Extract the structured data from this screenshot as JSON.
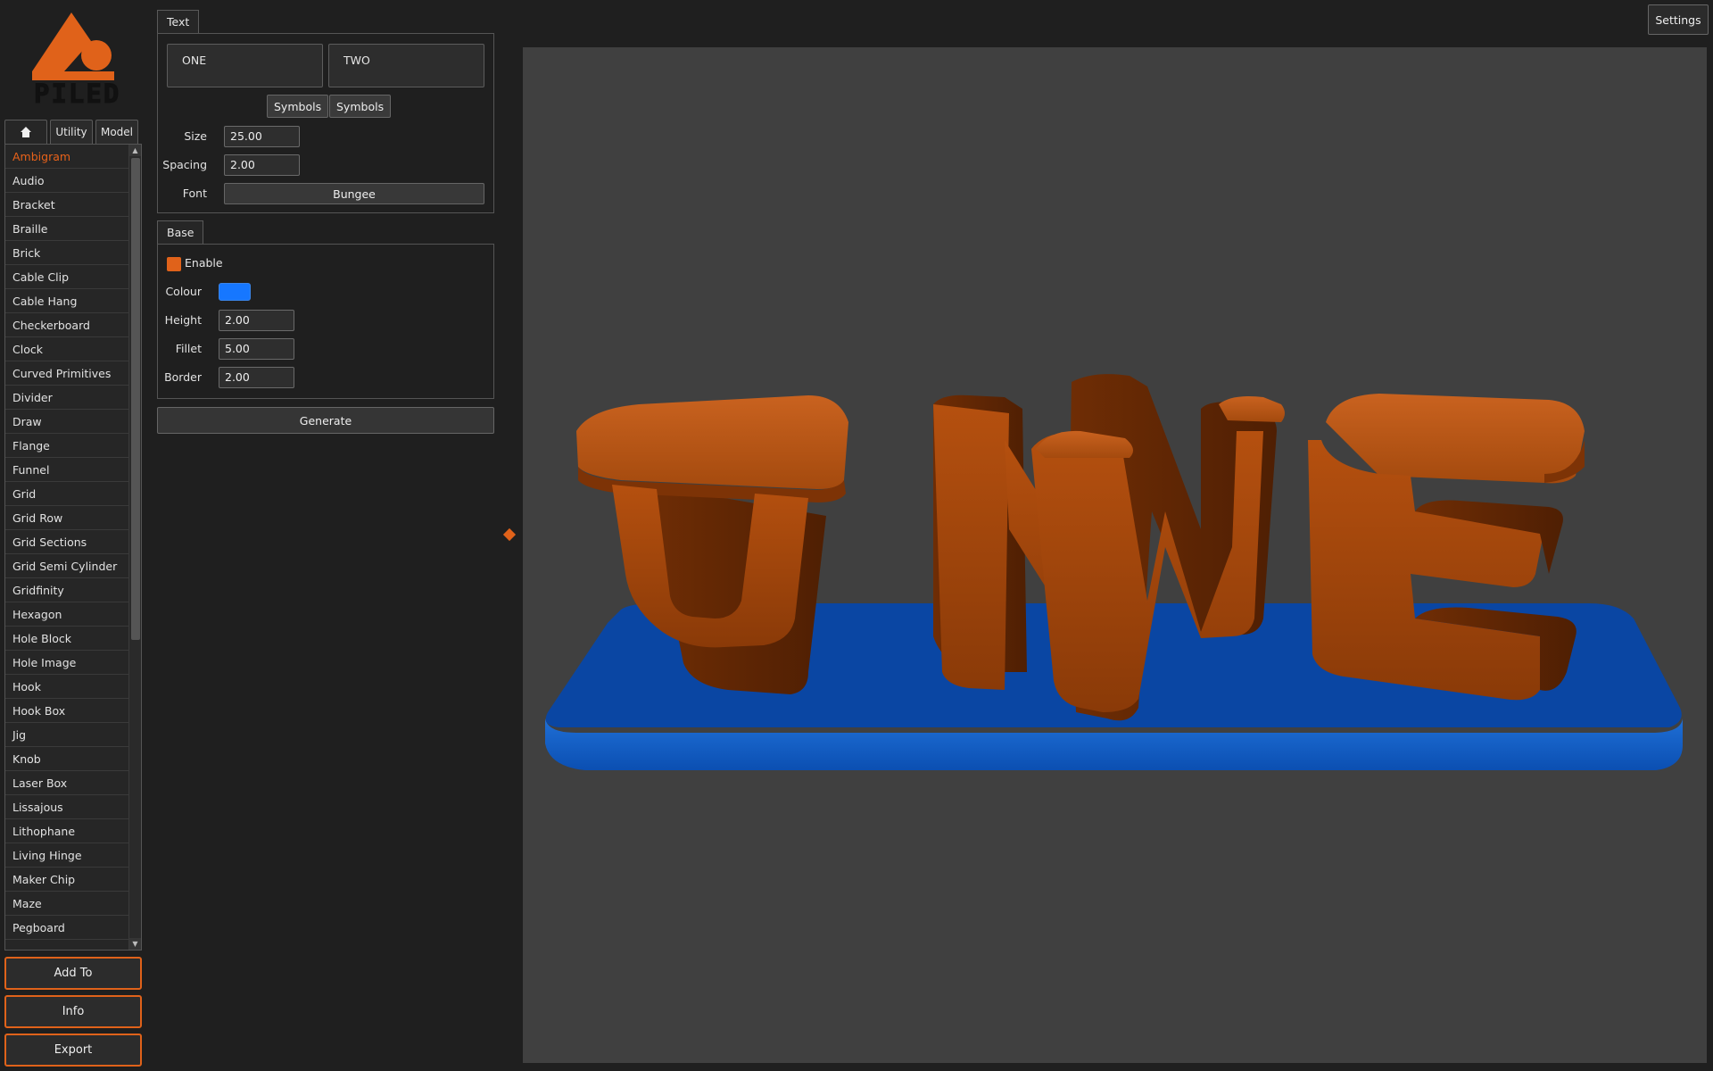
{
  "app": {
    "logo_text": "PILED",
    "accent_color": "#e0621a",
    "base_color": "#1677ff"
  },
  "left_tabs": {
    "home_icon": "home-icon",
    "utility": "Utility",
    "model": "Model"
  },
  "model_list": {
    "selected": "Ambigram",
    "items": [
      "Ambigram",
      "Audio",
      "Bracket",
      "Braille",
      "Brick",
      "Cable Clip",
      "Cable Hang",
      "Checkerboard",
      "Clock",
      "Curved Primitives",
      "Divider",
      "Draw",
      "Flange",
      "Funnel",
      "Grid",
      "Grid Row",
      "Grid Sections",
      "Grid Semi Cylinder",
      "Gridfinity",
      "Hexagon",
      "Hole Block",
      "Hole Image",
      "Hook",
      "Hook Box",
      "Jig",
      "Knob",
      "Laser Box",
      "Lissajous",
      "Lithophane",
      "Living Hinge",
      "Maker Chip",
      "Maze",
      "Pegboard"
    ]
  },
  "actions": {
    "add_to": "Add To",
    "info": "Info",
    "export": "Export"
  },
  "text_group": {
    "title": "Text",
    "text_one": "ONE",
    "text_two": "TWO",
    "symbols_one": "Symbols",
    "symbols_two": "Symbols",
    "size_label": "Size",
    "size_value": "25.00",
    "spacing_label": "Spacing",
    "spacing_value": "2.00",
    "font_label": "Font",
    "font_value": "Bungee"
  },
  "base_group": {
    "title": "Base",
    "enable_label": "Enable",
    "enabled": true,
    "colour_label": "Colour",
    "height_label": "Height",
    "height_value": "2.00",
    "fillet_label": "Fillet",
    "fillet_value": "5.00",
    "border_label": "Border",
    "border_value": "2.00"
  },
  "generate_label": "Generate",
  "settings_label": "Settings"
}
